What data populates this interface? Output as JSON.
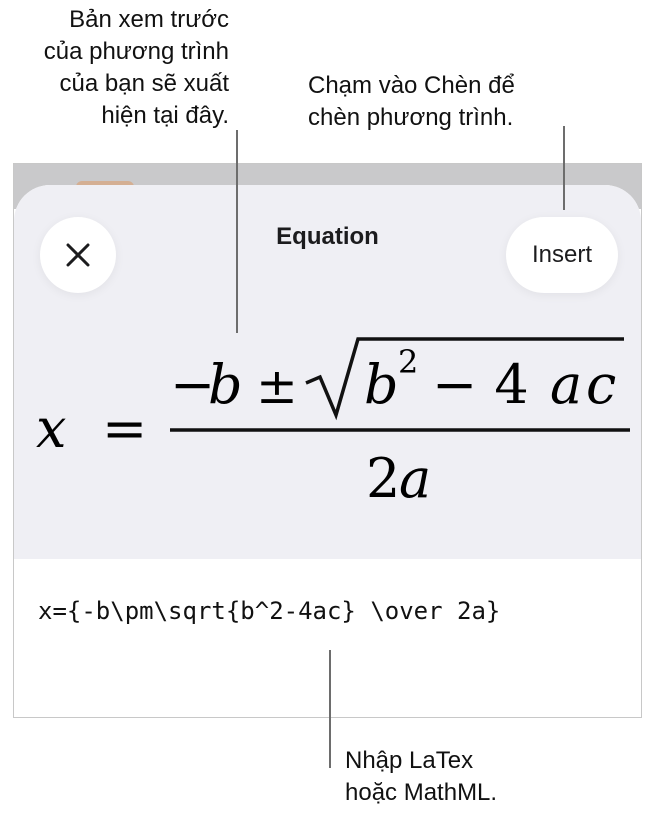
{
  "callouts": {
    "preview": [
      "Bản xem trước",
      "của phương trình",
      "của bạn sẽ xuất",
      "hiện tại đây."
    ],
    "insert": [
      "Chạm vào Chèn để",
      "chèn phương trình."
    ],
    "input": [
      "Nhập LaTex",
      "hoặc MathML."
    ]
  },
  "sheet": {
    "title": "Equation",
    "insert_label": "Insert",
    "close_icon": "close-icon"
  },
  "equation": {
    "lhs": "x",
    "equals": "=",
    "minus": "−",
    "b": "b",
    "pm": "±",
    "radicand_b": "b",
    "exponent": "2",
    "radicand_rest": "− 4",
    "a": "a",
    "c": "c",
    "den_coef": "2",
    "den_var": "a"
  },
  "input": {
    "latex": "x={-b\\pm\\sqrt{b^2-4ac} \\over 2a}"
  },
  "colors": {
    "preview_bg": "#efeff4",
    "backdrop": "#c9c9cb",
    "leader_line": "#6d6d6d"
  }
}
